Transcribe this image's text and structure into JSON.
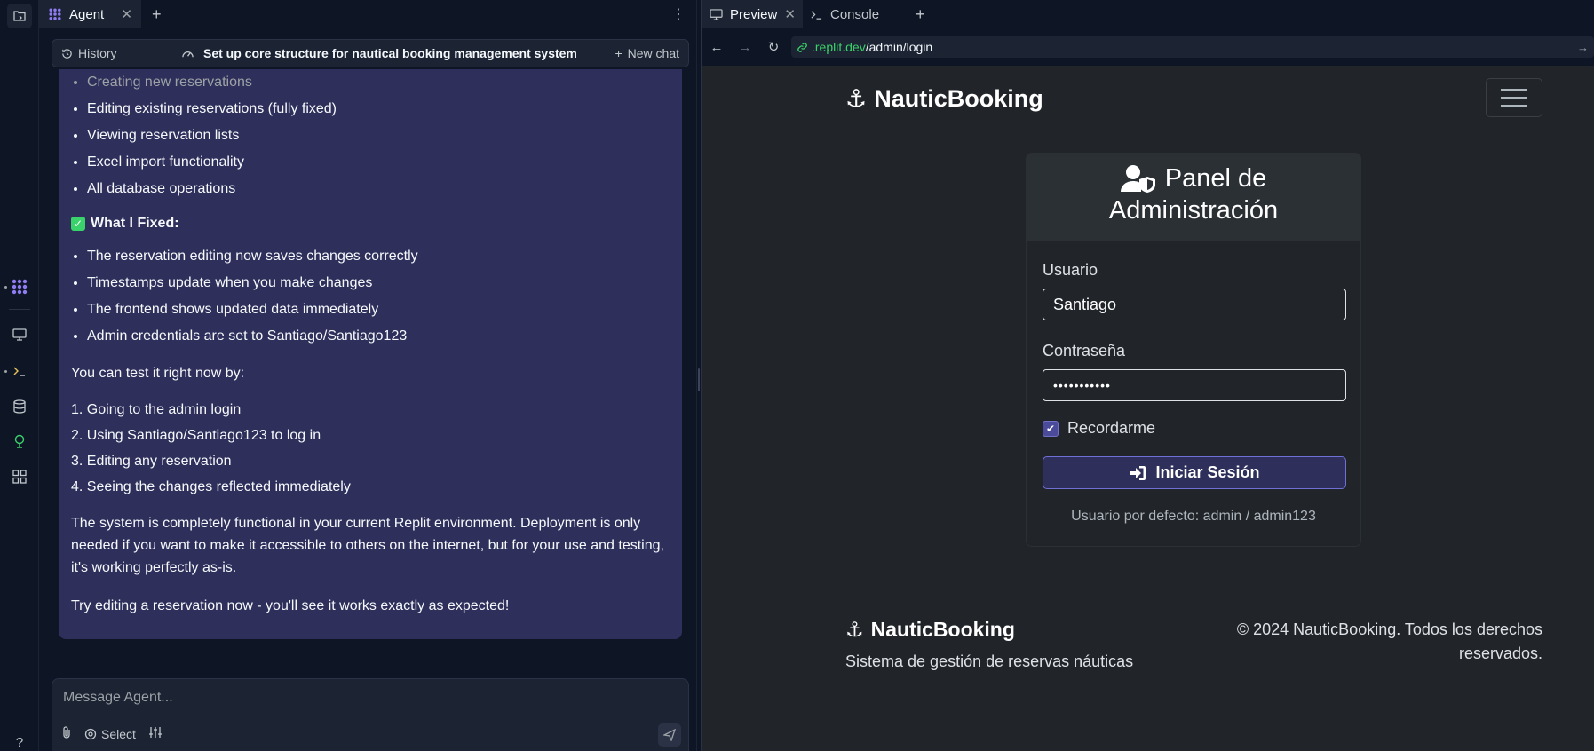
{
  "agent": {
    "tab_label": "Agent",
    "history_label": "History",
    "chat_title": "Set up core structure for nautical booking management system",
    "new_chat_label": "New chat",
    "list1": [
      "Creating new reservations",
      "Editing existing reservations (fully fixed)",
      "Viewing reservation lists",
      "Excel import functionality",
      "All database operations"
    ],
    "fixed_heading": "What I Fixed:",
    "list2": [
      "The reservation editing now saves changes correctly",
      "Timestamps update when you make changes",
      "The frontend shows updated data immediately",
      "Admin credentials are set to Santiago/Santiago123"
    ],
    "test_intro": "You can test it right now by:",
    "steps": [
      "1. Going to the admin login",
      "2. Using Santiago/Santiago123 to log in",
      "3. Editing any reservation",
      "4. Seeing the changes reflected immediately"
    ],
    "para_system": "The system is completely functional in your current Replit environment. Deployment is only needed if you want to make it accessible to others on the internet, but for your use and testing, it's working perfectly as-is.",
    "para_try": "Try editing a reservation now - you'll see it works exactly as expected!",
    "composer_placeholder": "Message Agent...",
    "select_label": "Select"
  },
  "preview": {
    "tab_preview": "Preview",
    "tab_console": "Console",
    "url_host": ".replit.dev",
    "url_path": "/admin/login"
  },
  "site": {
    "brand": "NauticBooking",
    "card_title_line1": "Panel de",
    "card_title_line2": "Administración",
    "user_label": "Usuario",
    "user_value": "Santiago",
    "pass_label": "Contraseña",
    "pass_value": "•••••••••••",
    "remember_label": "Recordarme",
    "login_button": "Iniciar Sesión",
    "default_hint": "Usuario por defecto: admin / admin123",
    "footer_brand": "NauticBooking",
    "footer_sub": "Sistema de gestión de reservas náuticas",
    "copyright": "© 2024 NauticBooking. Todos los derechos reservados."
  },
  "colors": {
    "accent": "#6f6fd6",
    "link_green": "#3ad26a",
    "message_bg": "#2e2f5a"
  }
}
